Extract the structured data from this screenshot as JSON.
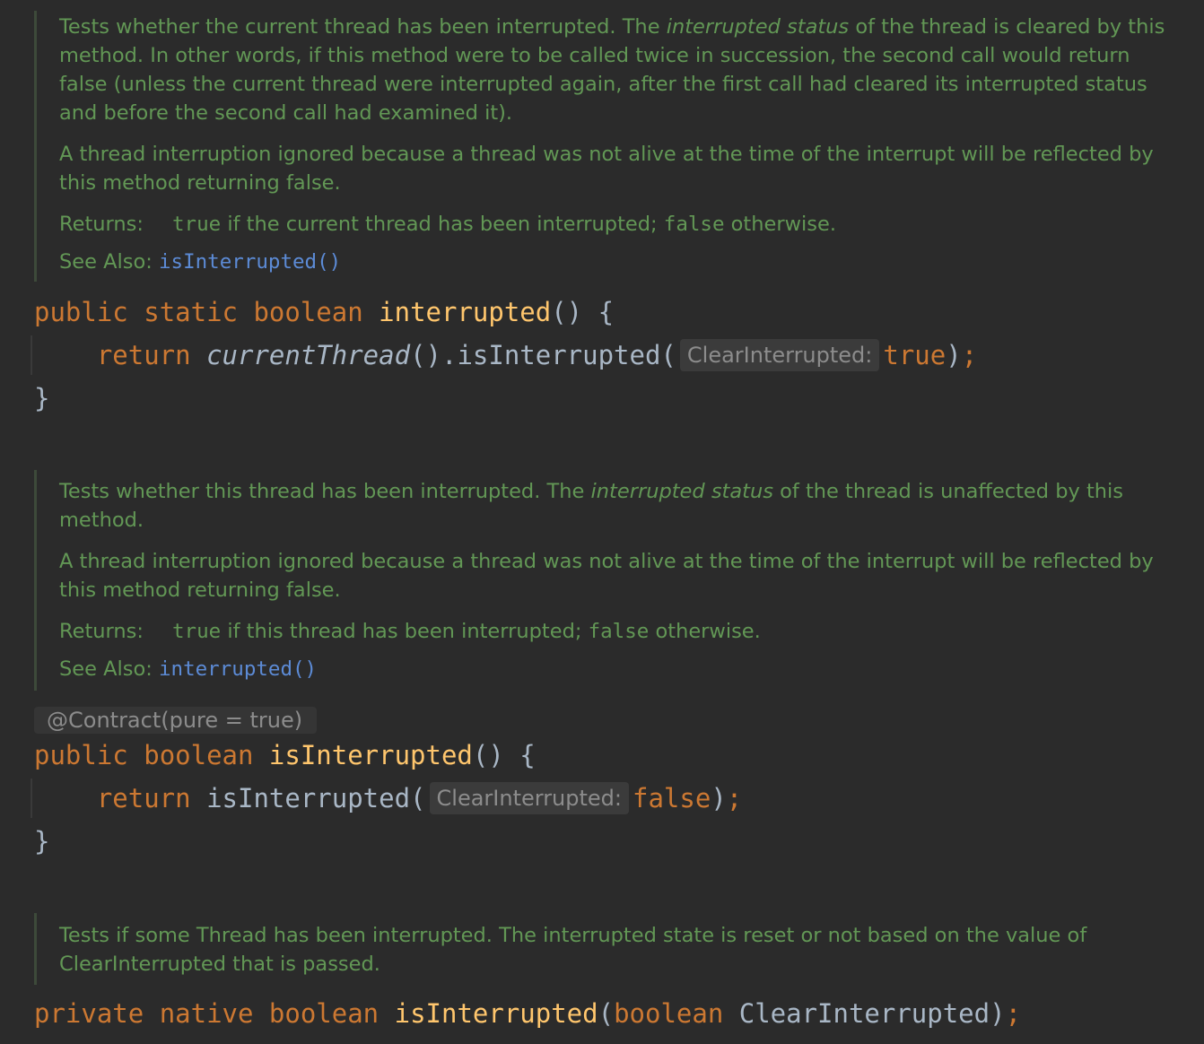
{
  "doc1": {
    "p1_a": "Tests whether the current thread has been interrupted. The ",
    "p1_em": "interrupted status",
    "p1_b": " of the thread is cleared by this method. In other words, if this method were to be called twice in succession, the second call would return false (unless the current thread were interrupted again, after the first call had cleared its interrupted status and before the second call had examined it).",
    "p2": "A thread interruption ignored because a thread was not alive at the time of the interrupt will be reflected by this method returning false.",
    "returns_label": "Returns:",
    "returns_true": "true",
    "returns_mid": " if the current thread has been interrupted; ",
    "returns_false": "false",
    "returns_end": " otherwise.",
    "see_label": "See Also:",
    "see_link": "isInterrupted()"
  },
  "code1": {
    "public": "public",
    "static": "static",
    "boolean": "boolean",
    "name": "interrupted",
    "parens": "()",
    "brace_open": "{",
    "return": "return",
    "call1": "currentThread",
    "call1_parens": "()",
    "call2": ".isInterrupted(",
    "hint": "ClearInterrupted:",
    "arg": "true",
    "close": ")",
    "semi": ";",
    "brace_close": "}"
  },
  "doc2": {
    "p1_a": "Tests whether this thread has been interrupted. The ",
    "p1_em": "interrupted status",
    "p1_b": " of the thread is unaffected by this method.",
    "p2": "A thread interruption ignored because a thread was not alive at the time of the interrupt will be reflected by this method returning false.",
    "returns_label": "Returns:",
    "returns_true": "true",
    "returns_mid": " if this thread has been interrupted; ",
    "returns_false": "false",
    "returns_end": " otherwise.",
    "see_label": "See Also:",
    "see_link": "interrupted()"
  },
  "annotation": "@Contract(pure = true)",
  "code2": {
    "public": "public",
    "boolean": "boolean",
    "name": "isInterrupted",
    "parens": "()",
    "brace_open": "{",
    "return": "return",
    "call": "isInterrupted(",
    "hint": "ClearInterrupted:",
    "arg": "false",
    "close": ")",
    "semi": ";",
    "brace_close": "}"
  },
  "doc3": {
    "p1": "Tests if some Thread has been interrupted. The interrupted state is reset or not based on the value of ClearInterrupted that is passed."
  },
  "code3": {
    "private": "private",
    "native": "native",
    "boolean": "boolean",
    "name": "isInterrupted",
    "open": "(",
    "param_type": "boolean",
    "param_name": "ClearInterrupted",
    "close": ")",
    "semi": ";"
  }
}
